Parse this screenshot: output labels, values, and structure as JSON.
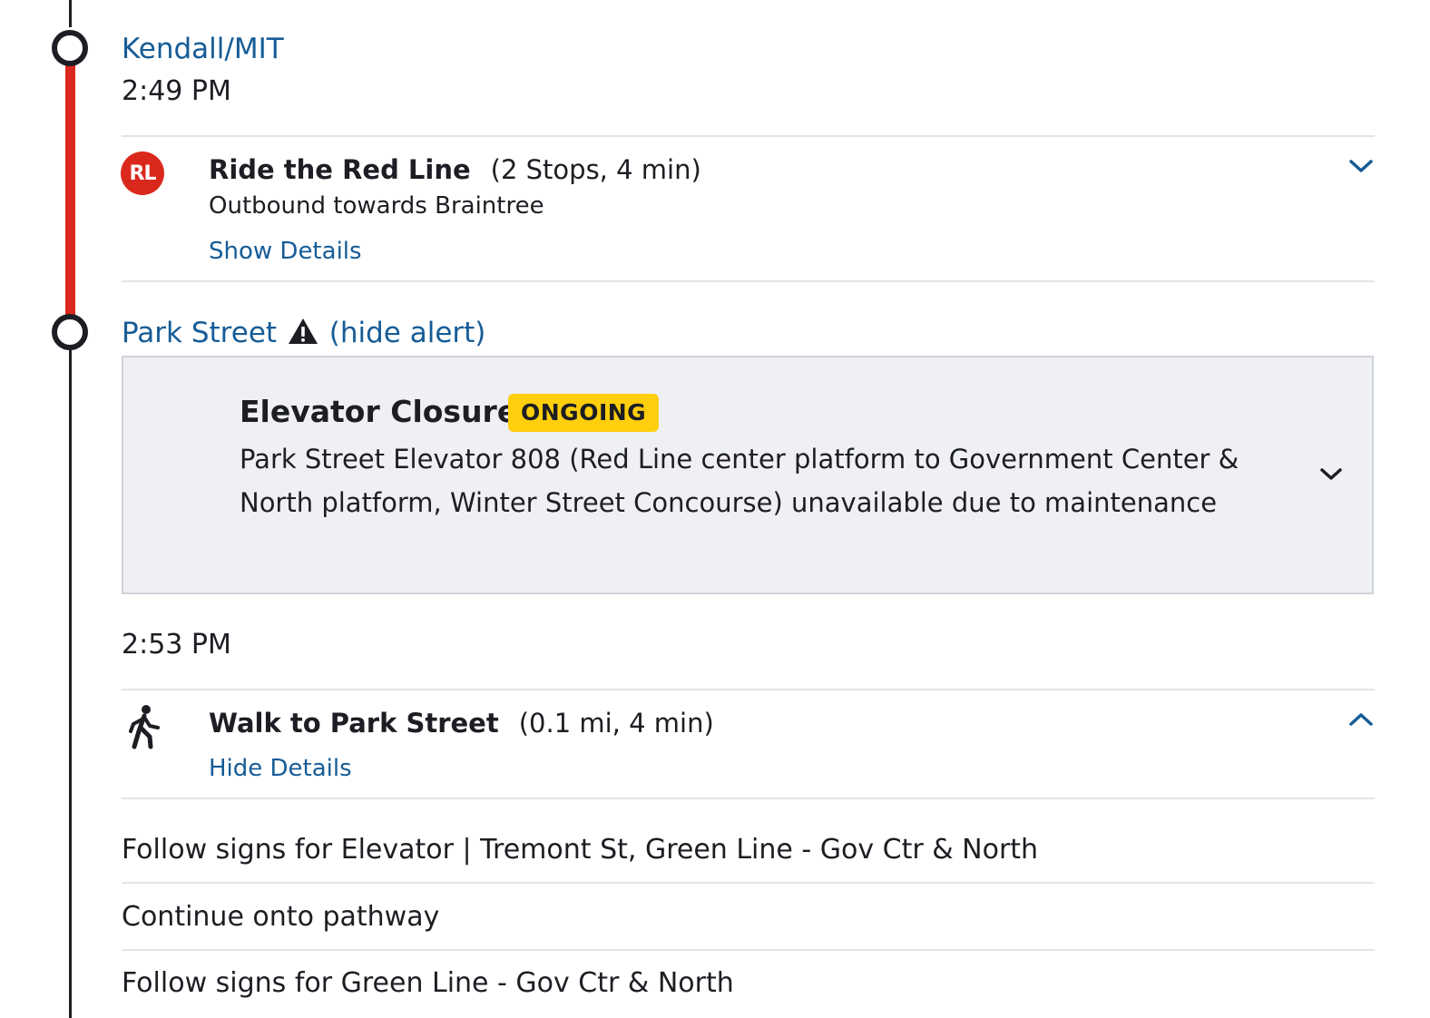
{
  "stops": [
    {
      "name": "Kendall/MIT",
      "time": "2:49 PM"
    },
    {
      "name": "Park Street",
      "hide_alert_label": "(hide alert)",
      "time": "2:53 PM"
    }
  ],
  "legs": {
    "red_line": {
      "badge": "RL",
      "title": "Ride the Red Line",
      "meta": "(2 Stops, 4 min)",
      "subtitle": "Outbound towards Braintree",
      "toggle_label": "Show Details",
      "expanded": false
    },
    "walk": {
      "icon": "walk-icon",
      "title": "Walk to Park Street",
      "meta": "(0.1 mi, 4 min)",
      "toggle_label": "Hide Details",
      "expanded": true
    }
  },
  "alert": {
    "icon": "warning-triangle-icon",
    "title": "Elevator Closure",
    "status_badge": "ONGOING",
    "description": "Park Street Elevator 808 (Red Line center platform to Government Center & North platform, Winter Street Concourse) unavailable due to maintenance"
  },
  "directions": [
    "Follow signs for Elevator | Tremont St, Green Line - Gov Ctr & North",
    "Continue onto pathway",
    "Follow signs for Green Line - Gov Ctr & North"
  ],
  "colors": {
    "red_line": "#da291c",
    "link": "#165c96",
    "alert_bg": "#eff0f3",
    "ongoing_badge": "#ffce0c"
  }
}
